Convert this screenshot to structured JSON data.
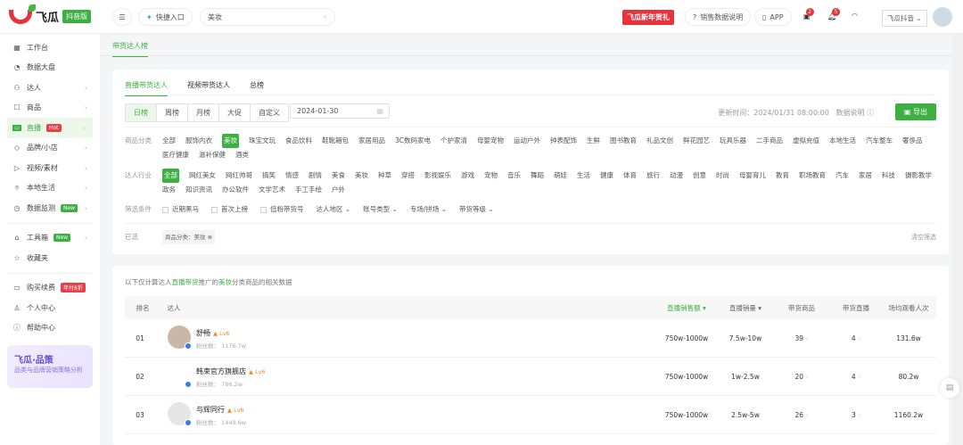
{
  "header": {
    "logo_name": "飞瓜",
    "logo_badge": "抖音版",
    "quick_entry": "快捷入口",
    "search_value": "美妆",
    "promo_banner": "飞瓜新年贺礼",
    "sales_data_desc": "销售数据说明",
    "app": "APP",
    "msg_count": "2",
    "notify_count": "5",
    "account": "飞瓜抖音"
  },
  "sidebar": {
    "items": [
      {
        "label": "工作台",
        "icon": "grid-icon"
      },
      {
        "label": "数据大盘",
        "icon": "pie-icon"
      },
      {
        "label": "达人",
        "icon": "user-icon"
      },
      {
        "label": "商品",
        "icon": "box-icon"
      },
      {
        "label": "直播",
        "icon": "tv-icon",
        "tag": "Hot"
      },
      {
        "label": "品牌/小店",
        "icon": "tag-icon"
      },
      {
        "label": "视频/素材",
        "icon": "play-icon"
      },
      {
        "label": "本地生活",
        "icon": "location-icon"
      },
      {
        "label": "数据监测",
        "icon": "monitor-icon",
        "tag": "New"
      }
    ],
    "tools": [
      {
        "label": "工具箱",
        "tag": "New"
      },
      {
        "label": "收藏夹"
      }
    ],
    "account": [
      {
        "label": "购买续费",
        "tag": "年付8折"
      },
      {
        "label": "个人中心"
      },
      {
        "label": "帮助中心"
      }
    ],
    "promo_title": "飞瓜·品策",
    "promo_sub": "品类与品牌营销策略分析"
  },
  "page_tab": "带货达人榜",
  "filters": {
    "tabs": [
      "直播带货达人",
      "视频带货达人",
      "总榜"
    ],
    "periods": [
      "日榜",
      "周榜",
      "月榜",
      "大促",
      "自定义"
    ],
    "date": "2024-01-30",
    "update_time": "更新时间：2024/01/31 08:00:00",
    "data_desc": "数据说明",
    "export": "导出",
    "category_label": "商品分类",
    "categories": [
      "全部",
      "服饰内衣",
      "美妆",
      "珠宝文玩",
      "食品饮料",
      "鞋靴箱包",
      "家居用品",
      "3C数码家电",
      "个护家清",
      "母婴宠物",
      "运动户外",
      "钟表配饰",
      "生鲜",
      "图书教育",
      "礼品文创",
      "鲜花园艺",
      "玩具乐器",
      "二手商品",
      "虚拟充值",
      "本地生活",
      "汽车整车",
      "奢侈品",
      "医疗健康",
      "滋补保健",
      "酒类"
    ],
    "category_selected": "美妆",
    "industry_label": "达人行业",
    "industries": [
      "全部",
      "网红美女",
      "网红帅哥",
      "搞笑",
      "情感",
      "剧情",
      "美食",
      "美妆",
      "种草",
      "穿搭",
      "影视娱乐",
      "游戏",
      "宠物",
      "音乐",
      "舞蹈",
      "萌娃",
      "生活",
      "健康",
      "体育",
      "旅行",
      "动漫",
      "创意",
      "时尚",
      "母婴育儿",
      "教育",
      "职场教育",
      "汽车",
      "家居",
      "科技",
      "摄影教学",
      "政务",
      "知识资讯",
      "办公软件",
      "文学艺术",
      "手工手绘",
      "户外"
    ],
    "industry_selected": "全部",
    "cond_label": "筛选条件",
    "checkboxes": [
      "近期黑马",
      "首次上榜",
      "低粉带货号"
    ],
    "dropdowns": [
      "达人地区",
      "账号类型",
      "专场/拼场",
      "带货等级"
    ],
    "selected_label": "已选",
    "selected_chip": "商品分类：美妆",
    "clear": "清空筛选"
  },
  "table": {
    "note_prefix": "以下仅计算达人",
    "note_hl1": "直播带货",
    "note_mid": "推广的",
    "note_hl2": "美妆",
    "note_suffix": "分类商品的相关数据",
    "headers": [
      "排名",
      "达人",
      "直播销售额",
      "直播销量",
      "带货商品",
      "带货直播",
      "场均观看人次"
    ],
    "rows": [
      {
        "rank": "01",
        "name": "舒畅",
        "level": "Lv6",
        "fans": "粉丝数： 1176.7w",
        "sales": "750w-1000w",
        "volume": "7.5w-10w",
        "products": "39",
        "lives": "4",
        "viewers": "131.6w"
      },
      {
        "rank": "02",
        "name": "韩束官方旗舰店",
        "level": "Lv6",
        "fans": "粉丝数： 786.2w",
        "sales": "750w-1000w",
        "volume": "1w-2.5w",
        "products": "20",
        "lives": "4",
        "viewers": "80.2w"
      },
      {
        "rank": "03",
        "name": "与辉同行",
        "level": "Lv6",
        "fans": "粉丝数： 1449.6w",
        "sales": "750w-1000w",
        "volume": "2.5w-5w",
        "products": "26",
        "lives": "3",
        "viewers": "1160.2w"
      }
    ]
  }
}
